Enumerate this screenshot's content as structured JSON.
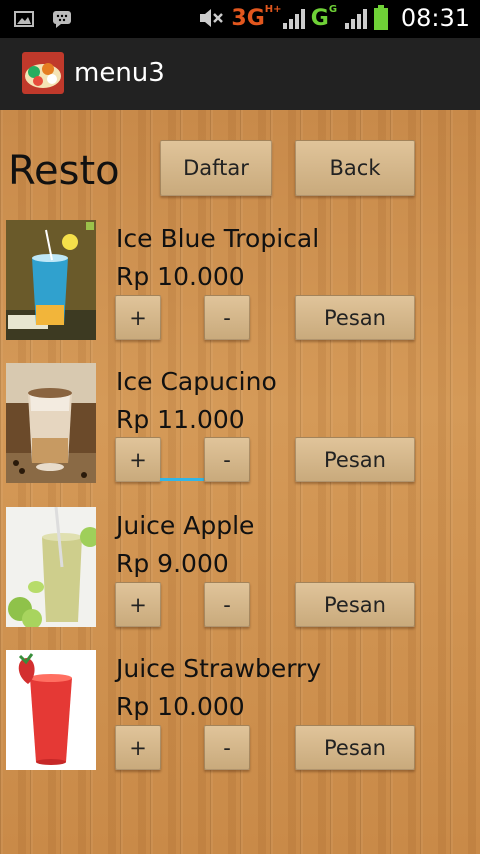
{
  "status_bar": {
    "network_1": "3G",
    "network_1_badge": "H+",
    "network_2": "G",
    "network_2_badge": "G",
    "time": "08:31"
  },
  "action_bar": {
    "title": "menu3"
  },
  "header": {
    "title": "Resto",
    "daftar_label": "Daftar",
    "back_label": "Back"
  },
  "items": [
    {
      "name": "Ice Blue Tropical",
      "price": "Rp 10.000",
      "plus": "+",
      "minus": "-",
      "order": "Pesan"
    },
    {
      "name": "Ice Capucino",
      "price": "Rp 11.000",
      "plus": "+",
      "minus": "-",
      "order": "Pesan"
    },
    {
      "name": "Juice Apple",
      "price": "Rp 9.000",
      "plus": "+",
      "minus": "-",
      "order": "Pesan"
    },
    {
      "name": "Juice Strawberry",
      "price": "Rp 10.000",
      "plus": "+",
      "minus": "-",
      "order": "Pesan"
    }
  ],
  "colors": {
    "network_accent": "#e2571e",
    "signal_accent": "#6fd137",
    "focus_underline": "#33b5e5"
  }
}
